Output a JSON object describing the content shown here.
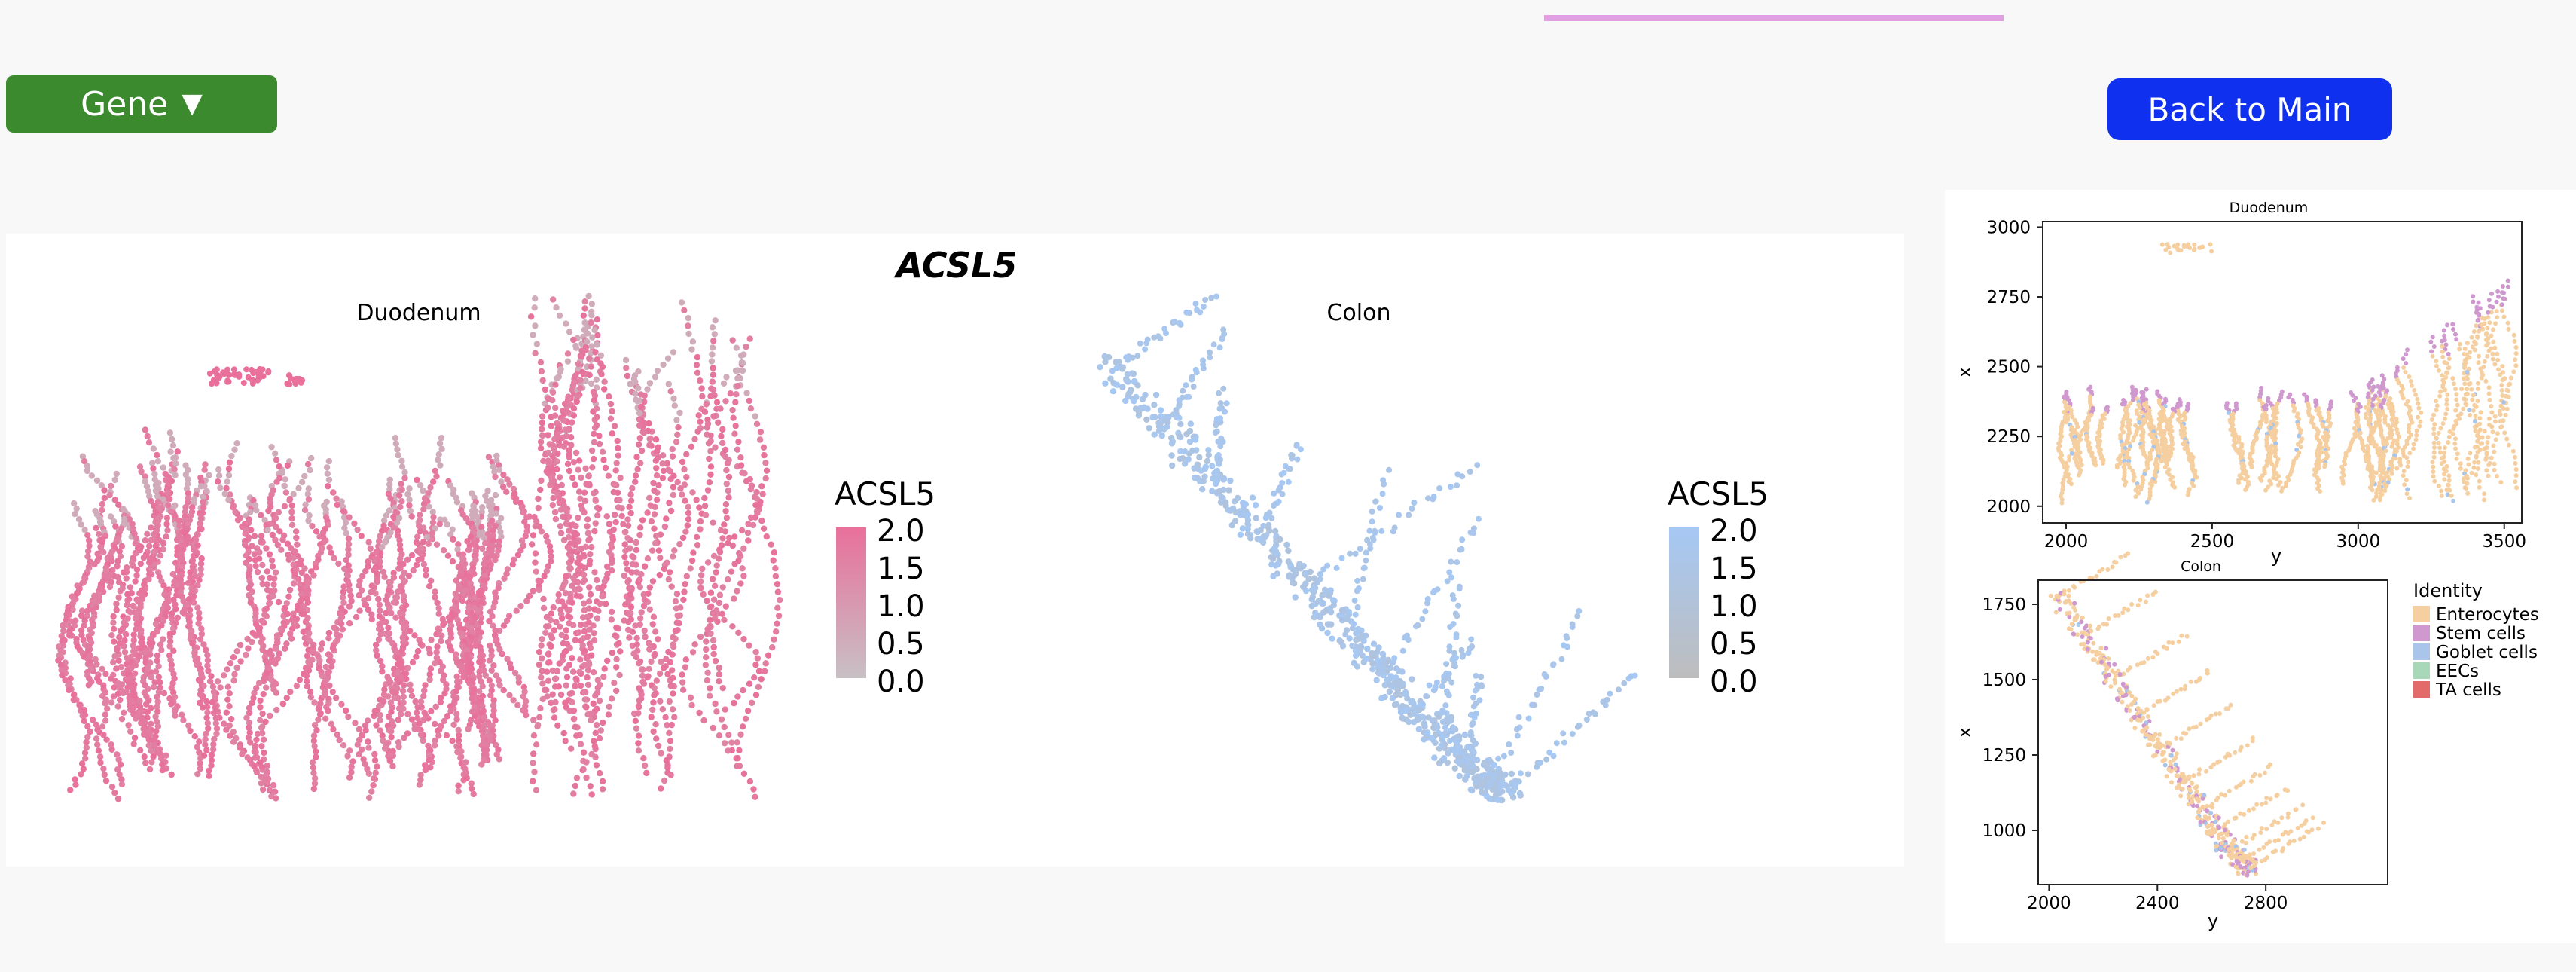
{
  "header": {
    "gene_button_label": "Gene",
    "gene_caret": "▼",
    "back_button_label": "Back to Main"
  },
  "colors": {
    "page_background": "#f8f8f8",
    "gene_button": "#3b8a2e",
    "back_button": "#1030f0",
    "top_accent": "#df9fe0",
    "duodenum_high": "#e8709a",
    "duodenum_low": "#c8c0c4",
    "colon_high": "#a6c8f4",
    "colon_low": "#bdbdbd"
  },
  "chart_data": [
    {
      "type": "scatter",
      "title": "ACSL5",
      "panels": [
        {
          "name": "Duodenum",
          "legend": {
            "title": "ACSL5",
            "ticks": [
              "2.0",
              "1.5",
              "1.0",
              "0.5",
              "0.0"
            ],
            "range": [
              0,
              2
            ],
            "high_color": "#e8709a",
            "low_color": "#c8c0c4",
            "placement": "right"
          }
        },
        {
          "name": "Colon",
          "legend": {
            "title": "ACSL5",
            "ticks": [
              "2.0",
              "1.5",
              "1.0",
              "0.5",
              "0.0"
            ],
            "range": [
              0,
              2
            ],
            "high_color": "#a6c8f4",
            "low_color": "#bdbdbd",
            "placement": "right"
          }
        }
      ],
      "grid": false
    },
    {
      "type": "scatter",
      "title": "Duodenum",
      "xlabel": "y",
      "ylabel": "x",
      "xlim": [
        1920,
        3560
      ],
      "ylim": [
        1940,
        3020
      ],
      "xticks": [
        "2000",
        "2500",
        "3000",
        "3500"
      ],
      "yticks": [
        "3000",
        "2750",
        "2500",
        "2250",
        "2000"
      ],
      "grid": false
    },
    {
      "type": "scatter",
      "title": "Colon",
      "xlabel": "y",
      "ylabel": "x",
      "xlim": [
        1960,
        3250
      ],
      "ylim": [
        820,
        1830
      ],
      "xticks": [
        "2000",
        "2400",
        "2800"
      ],
      "yticks": [
        "1750",
        "1500",
        "1250",
        "1000"
      ],
      "grid": false,
      "legend": {
        "title": "Identity",
        "placement": "right",
        "items": [
          {
            "label": "Enterocytes",
            "color": "#f5cfa0"
          },
          {
            "label": "Stem cells",
            "color": "#cf98cf"
          },
          {
            "label": "Goblet cells",
            "color": "#a9c6ea"
          },
          {
            "label": "EECs",
            "color": "#a8d8b8"
          },
          {
            "label": "TA cells",
            "color": "#e26a6a"
          }
        ]
      }
    }
  ]
}
